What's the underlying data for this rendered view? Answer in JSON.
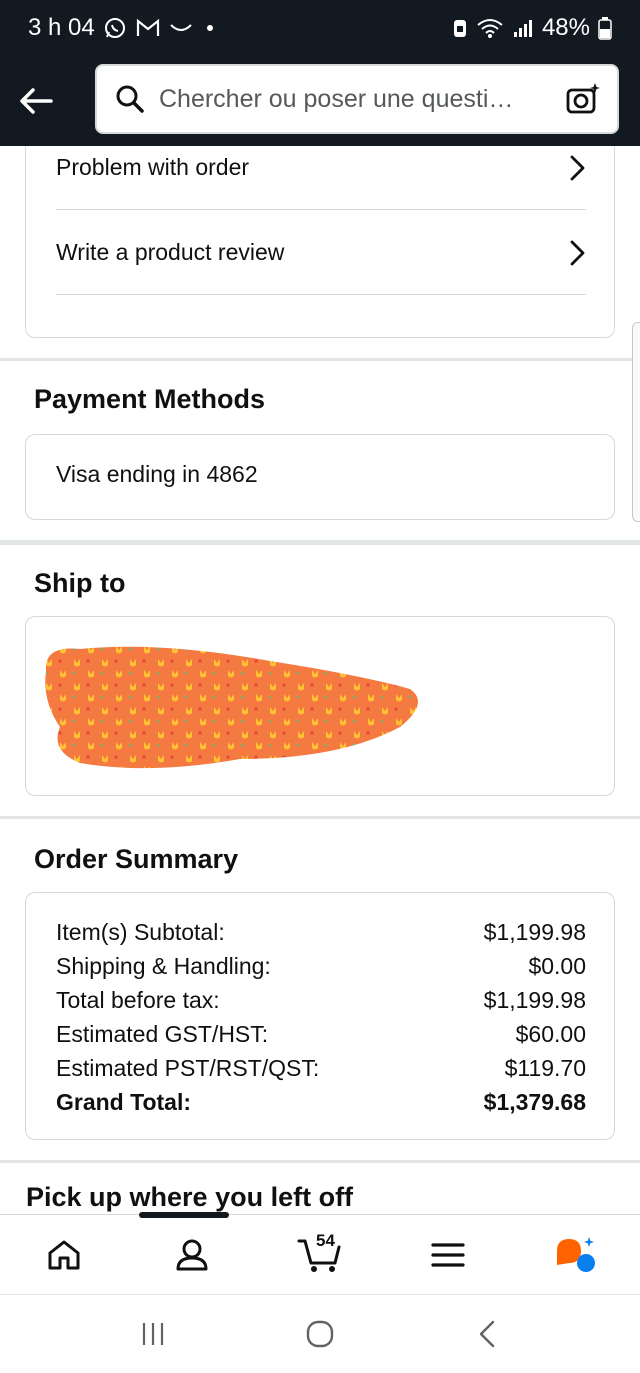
{
  "status_bar": {
    "time": "3 h 04",
    "battery": "48%",
    "icons": [
      "whatsapp-icon",
      "gmail-icon",
      "wave-icon",
      "notification-dot",
      "battery-saver-icon",
      "wifi-icon",
      "signal-icon",
      "battery-icon"
    ]
  },
  "search": {
    "placeholder": "Chercher ou poser une questi…",
    "search_icon": "search-icon",
    "camera_icon": "camera-search-icon"
  },
  "order_help": {
    "items": [
      {
        "label": "Problem with order",
        "icon": "chevron-right-icon"
      },
      {
        "label": "Write a product review",
        "icon": "chevron-right-icon"
      }
    ]
  },
  "payment": {
    "title": "Payment Methods",
    "method": "Visa  ending in 4862"
  },
  "ship_to": {
    "title": "Ship to"
  },
  "order_summary": {
    "title": "Order Summary",
    "rows": [
      {
        "label": "Item(s) Subtotal:",
        "value": "$1,199.98"
      },
      {
        "label": "Shipping & Handling:",
        "value": "$0.00"
      },
      {
        "label": "Total before tax:",
        "value": "$1,199.98"
      },
      {
        "label": "Estimated GST/HST:",
        "value": "$60.00"
      },
      {
        "label": "Estimated PST/RST/QST:",
        "value": "$119.70"
      },
      {
        "label": "Grand Total:",
        "value": "$1,379.68"
      }
    ]
  },
  "pickup": {
    "title": "Pick up where you left off"
  },
  "bottom_nav": {
    "cart_count": "54",
    "items": [
      "home-icon",
      "account-icon",
      "cart-icon",
      "menu-icon",
      "rufus-assistant-icon"
    ]
  },
  "colors": {
    "header_bg": "#131921",
    "border": "#d5d9d9",
    "divider": "#e3e6e6",
    "redaction": "#f47a42",
    "assistant_orange": "#ff6200",
    "assistant_blue": "#0a7ff0"
  }
}
